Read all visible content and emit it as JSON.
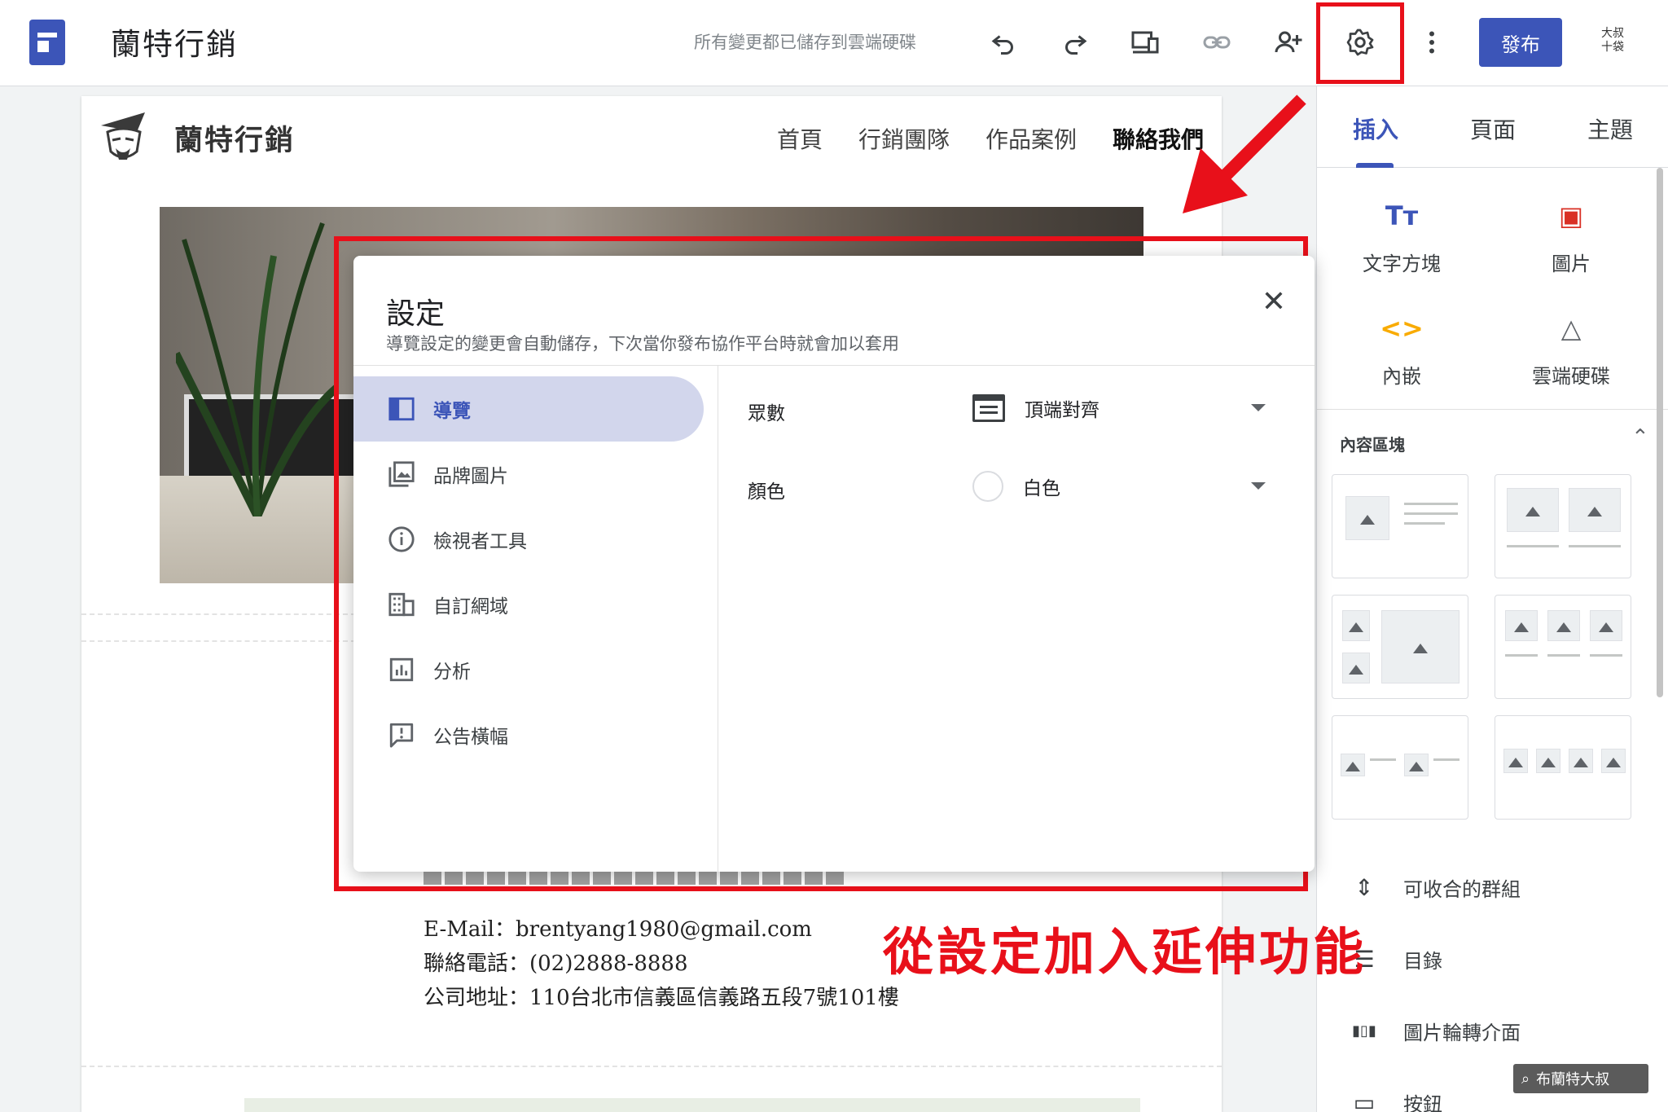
{
  "topbar": {
    "site_title": "蘭特行銷",
    "save_status": "所有變更都已儲存到雲端硬碟",
    "publish_label": "發布",
    "avatar_line1": "大叔",
    "avatar_line2": "十袋",
    "icons": [
      "undo-icon",
      "redo-icon",
      "device-preview-icon",
      "link-icon",
      "share-icon",
      "gear-icon",
      "more-vert-icon"
    ]
  },
  "page": {
    "brand_name": "蘭特行銷",
    "nav": [
      "首頁",
      "行銷團隊",
      "作品案例",
      "聯絡我們"
    ],
    "nav_active_index": 3,
    "contact": {
      "email": "E-Mail：brentyang1980@gmail.com",
      "phone": "聯絡電話：(02)2888-8888",
      "address": "公司地址：110台北市信義區信義路五段7號101樓"
    }
  },
  "dialog": {
    "title": "設定",
    "subtitle": "導覽設定的變更會自動儲存，下次當你發布協作平台時就會加以套用",
    "nav_items": [
      {
        "label": "導覽",
        "icon": "navigation-icon"
      },
      {
        "label": "品牌圖片",
        "icon": "brand-images-icon"
      },
      {
        "label": "檢視者工具",
        "icon": "info-icon"
      },
      {
        "label": "自訂網域",
        "icon": "domain-icon"
      },
      {
        "label": "分析",
        "icon": "analytics-icon"
      },
      {
        "label": "公告橫幅",
        "icon": "announcement-icon"
      }
    ],
    "active_nav_index": 0,
    "rows": [
      {
        "label": "眾數",
        "value": "頂端對齊"
      },
      {
        "label": "顏色",
        "value": "白色"
      }
    ]
  },
  "sidepanel": {
    "tabs": [
      "插入",
      "頁面",
      "主題"
    ],
    "active_tab_index": 0,
    "tools": [
      {
        "label": "文字方塊",
        "glyph": "Tт",
        "icon": "text-box-icon"
      },
      {
        "label": "圖片",
        "glyph": "▣",
        "icon": "image-icon"
      },
      {
        "label": "內嵌",
        "glyph": "<>",
        "icon": "embed-icon"
      },
      {
        "label": "雲端硬碟",
        "glyph": "△",
        "icon": "drive-icon"
      }
    ],
    "blocks_label": "內容區塊",
    "items": [
      {
        "label": "可收合的群組",
        "glyph": "⇕",
        "icon": "collapsible-group-icon"
      },
      {
        "label": "目錄",
        "glyph": "☰",
        "icon": "table-of-contents-icon"
      },
      {
        "label": "圖片輪轉介面",
        "glyph": "▮▯▮",
        "icon": "carousel-icon"
      },
      {
        "label": "按鈕",
        "glyph": "▭",
        "icon": "button-icon"
      }
    ]
  },
  "annotation": "從設定加入延伸功能",
  "watermark": "布蘭特大叔",
  "colors": {
    "accent": "#3c55b8",
    "highlight": "#e8101a",
    "active_nav_bg": "#d2d6ec"
  }
}
